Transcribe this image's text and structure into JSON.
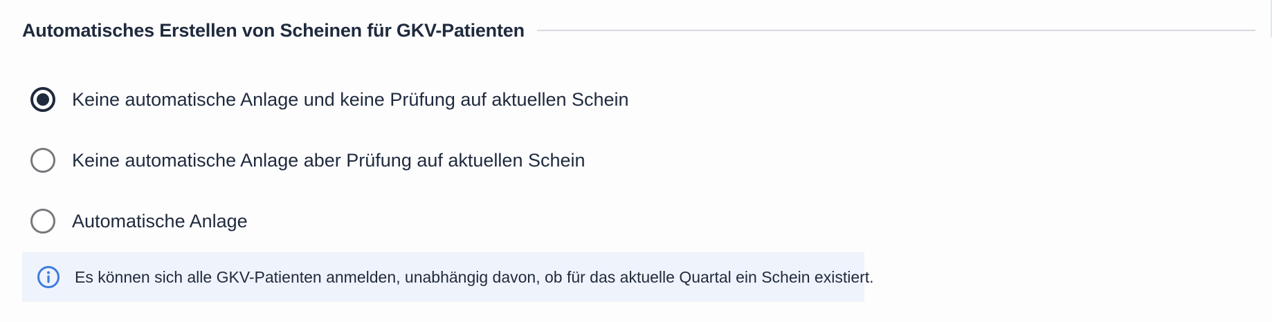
{
  "section": {
    "title": "Automatisches Erstellen von Scheinen für GKV-Patienten"
  },
  "options": {
    "selected_index": 0,
    "items": [
      {
        "label": "Keine automatische Anlage und keine Prüfung auf aktuellen Schein",
        "checked": true
      },
      {
        "label": "Keine automatische Anlage aber Prüfung auf aktuellen Schein",
        "checked": false
      },
      {
        "label": "Automatische Anlage",
        "checked": false
      }
    ]
  },
  "info": {
    "icon": "info-icon",
    "text": "Es können sich alle GKV-Patienten anmelden, unabhängig davon, ob für das aktuelle Quartal ein Schein existiert."
  },
  "colors": {
    "text": "#1f2a3d",
    "info_background": "#eff3fb",
    "info_icon": "#3d7be0",
    "radio_unchecked_border": "#76787c",
    "divider": "#d6d9de"
  }
}
